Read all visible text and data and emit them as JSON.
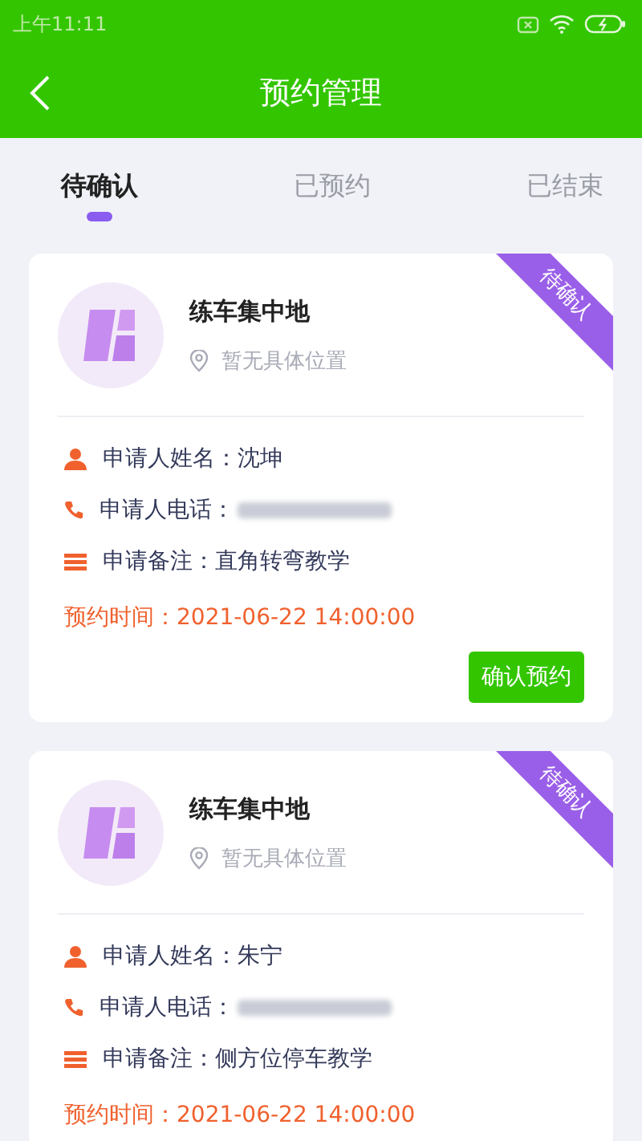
{
  "status_bar": {
    "time": "上午11:11"
  },
  "header": {
    "title": "预约管理"
  },
  "tabs": [
    {
      "label": "待确认",
      "selected": true
    },
    {
      "label": "已预约",
      "selected": false
    },
    {
      "label": "已结束",
      "selected": false
    }
  ],
  "cards": [
    {
      "badge": "待确认",
      "place": "练车集中地",
      "location": "暂无具体位置",
      "name_label": "申请人姓名：",
      "name": "沈坤",
      "phone_label": "申请人电话：",
      "note_label": "申请备注：",
      "note": "直角转弯教学",
      "time": "预约时间：2021-06-22 14:00:00",
      "button": "确认预约"
    },
    {
      "badge": "待确认",
      "place": "练车集中地",
      "location": "暂无具体位置",
      "name_label": "申请人姓名：",
      "name": "朱宁",
      "phone_label": "申请人电话：",
      "note_label": "申请备注：",
      "note": "侧方位停车教学",
      "time": "预约时间：2021-06-22 14:00:00"
    }
  ]
}
